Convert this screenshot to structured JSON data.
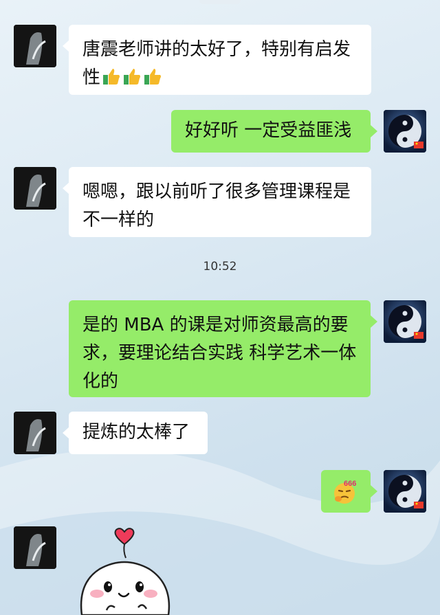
{
  "messages": [
    {
      "side": "left",
      "text": "唐震老师讲的太好了，特别有启发性",
      "emoji": "thumbs-up x3"
    },
    {
      "side": "right",
      "text": "好好听 一定受益匪浅"
    },
    {
      "side": "left",
      "text": "嗯嗯，跟以前听了很多管理课程是不一样的"
    },
    {
      "side": "right",
      "text": "是的 MBA 的课是对师资最高的要求，要理论结合实践 科学艺术一体化的"
    },
    {
      "side": "left",
      "text": "提炼的太棒了"
    },
    {
      "side": "right",
      "sticker": "666-emoji",
      "sticker_text": "666"
    },
    {
      "side": "left",
      "sticker": "heart-balloon-cartoon"
    }
  ],
  "timestamp": "10:52",
  "colors": {
    "sent_bubble": "#95ec69",
    "received_bubble": "#ffffff",
    "flag": "#e8392b"
  }
}
